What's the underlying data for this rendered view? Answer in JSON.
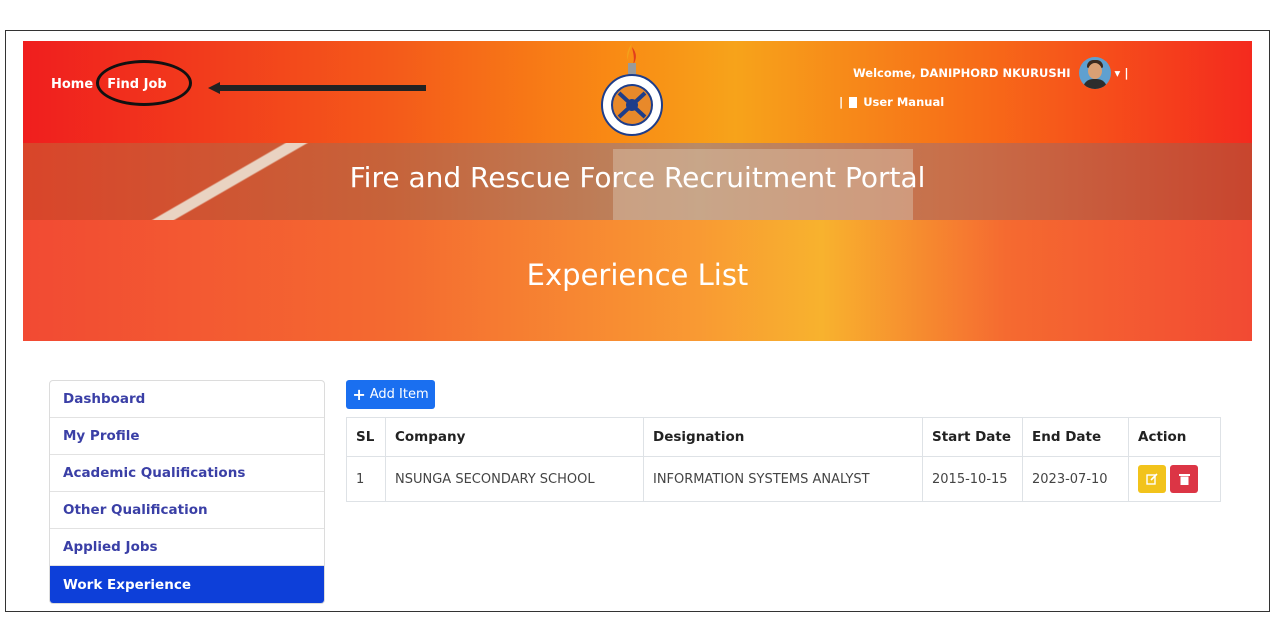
{
  "nav": {
    "home": "Home",
    "find_job": "Find Job"
  },
  "header": {
    "welcome": "Welcome, DANIPHORD NKURUSHI",
    "caret": "▾",
    "separator": "|",
    "user_manual": "User Manual"
  },
  "hero": {
    "title": "Fire and Rescue Force Recruitment Portal"
  },
  "page": {
    "title": "Experience List"
  },
  "sidebar": {
    "items": [
      {
        "label": "Dashboard"
      },
      {
        "label": "My Profile"
      },
      {
        "label": "Academic Qualifications"
      },
      {
        "label": "Other Qualification"
      },
      {
        "label": "Applied Jobs"
      },
      {
        "label": "Work Experience"
      }
    ]
  },
  "actions": {
    "add_item": "Add Item"
  },
  "table": {
    "headers": [
      "SL",
      "Company",
      "Designation",
      "Start Date",
      "End Date",
      "Action"
    ],
    "rows": [
      {
        "sl": "1",
        "company": "NSUNGA SECONDARY SCHOOL",
        "designation": "INFORMATION SYSTEMS ANALYST",
        "start": "2015-10-15",
        "end": "2023-07-10"
      }
    ]
  },
  "colors": {
    "active_nav": "#0d3fd9",
    "link": "#3a3fa6",
    "add_button": "#1a6ff0",
    "edit": "#f2c31b",
    "delete": "#dc3545"
  }
}
